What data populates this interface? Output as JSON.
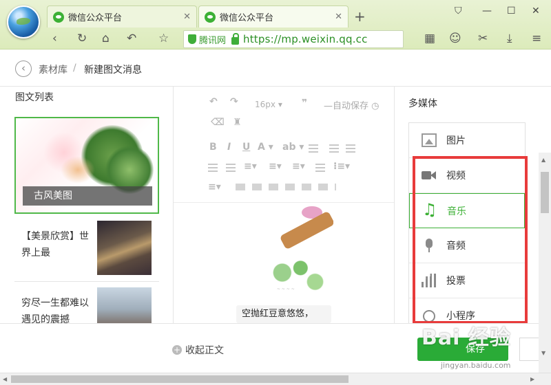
{
  "browser": {
    "tabs": [
      {
        "title": "微信公众平台"
      },
      {
        "title": "微信公众平台"
      }
    ],
    "new_tab": "+",
    "address": {
      "site_badge": "腾讯网",
      "url": "https://mp.weixin.qq.cc"
    },
    "icons": [
      "back-arrow",
      "refresh",
      "home",
      "undo",
      "star",
      "grid",
      "wechat-face",
      "scissors",
      "download",
      "menu"
    ]
  },
  "breadcrumb": {
    "back": "‹",
    "parent": "素材库",
    "separator": "/",
    "current": "新建图文消息"
  },
  "article_list": {
    "title": "图文列表",
    "cover_caption": "古风美图",
    "items": [
      {
        "text": "【美景欣赏】世界上最"
      },
      {
        "text": "穷尽一生都难以遇见的震撼"
      }
    ]
  },
  "editor": {
    "font_size": "16px",
    "autosave": "自动保存",
    "content_line": "空抛红豆意悠悠，"
  },
  "media_panel": {
    "title": "多媒体",
    "items": [
      {
        "label": "图片",
        "icon": "image-icon"
      },
      {
        "label": "视频",
        "icon": "video-icon"
      },
      {
        "label": "音乐",
        "icon": "music-icon",
        "active": true
      },
      {
        "label": "音频",
        "icon": "microphone-icon"
      },
      {
        "label": "投票",
        "icon": "bar-chart-icon"
      },
      {
        "label": "小程序",
        "icon": "mini-program-icon"
      }
    ],
    "highlight_color": "#e83b3b",
    "active_color": "#3cb035"
  },
  "footer": {
    "collapse": "收起正文",
    "save": "保存",
    "watermark": "Bai 经验",
    "watermark_sub": "jingyan.baidu.com"
  }
}
